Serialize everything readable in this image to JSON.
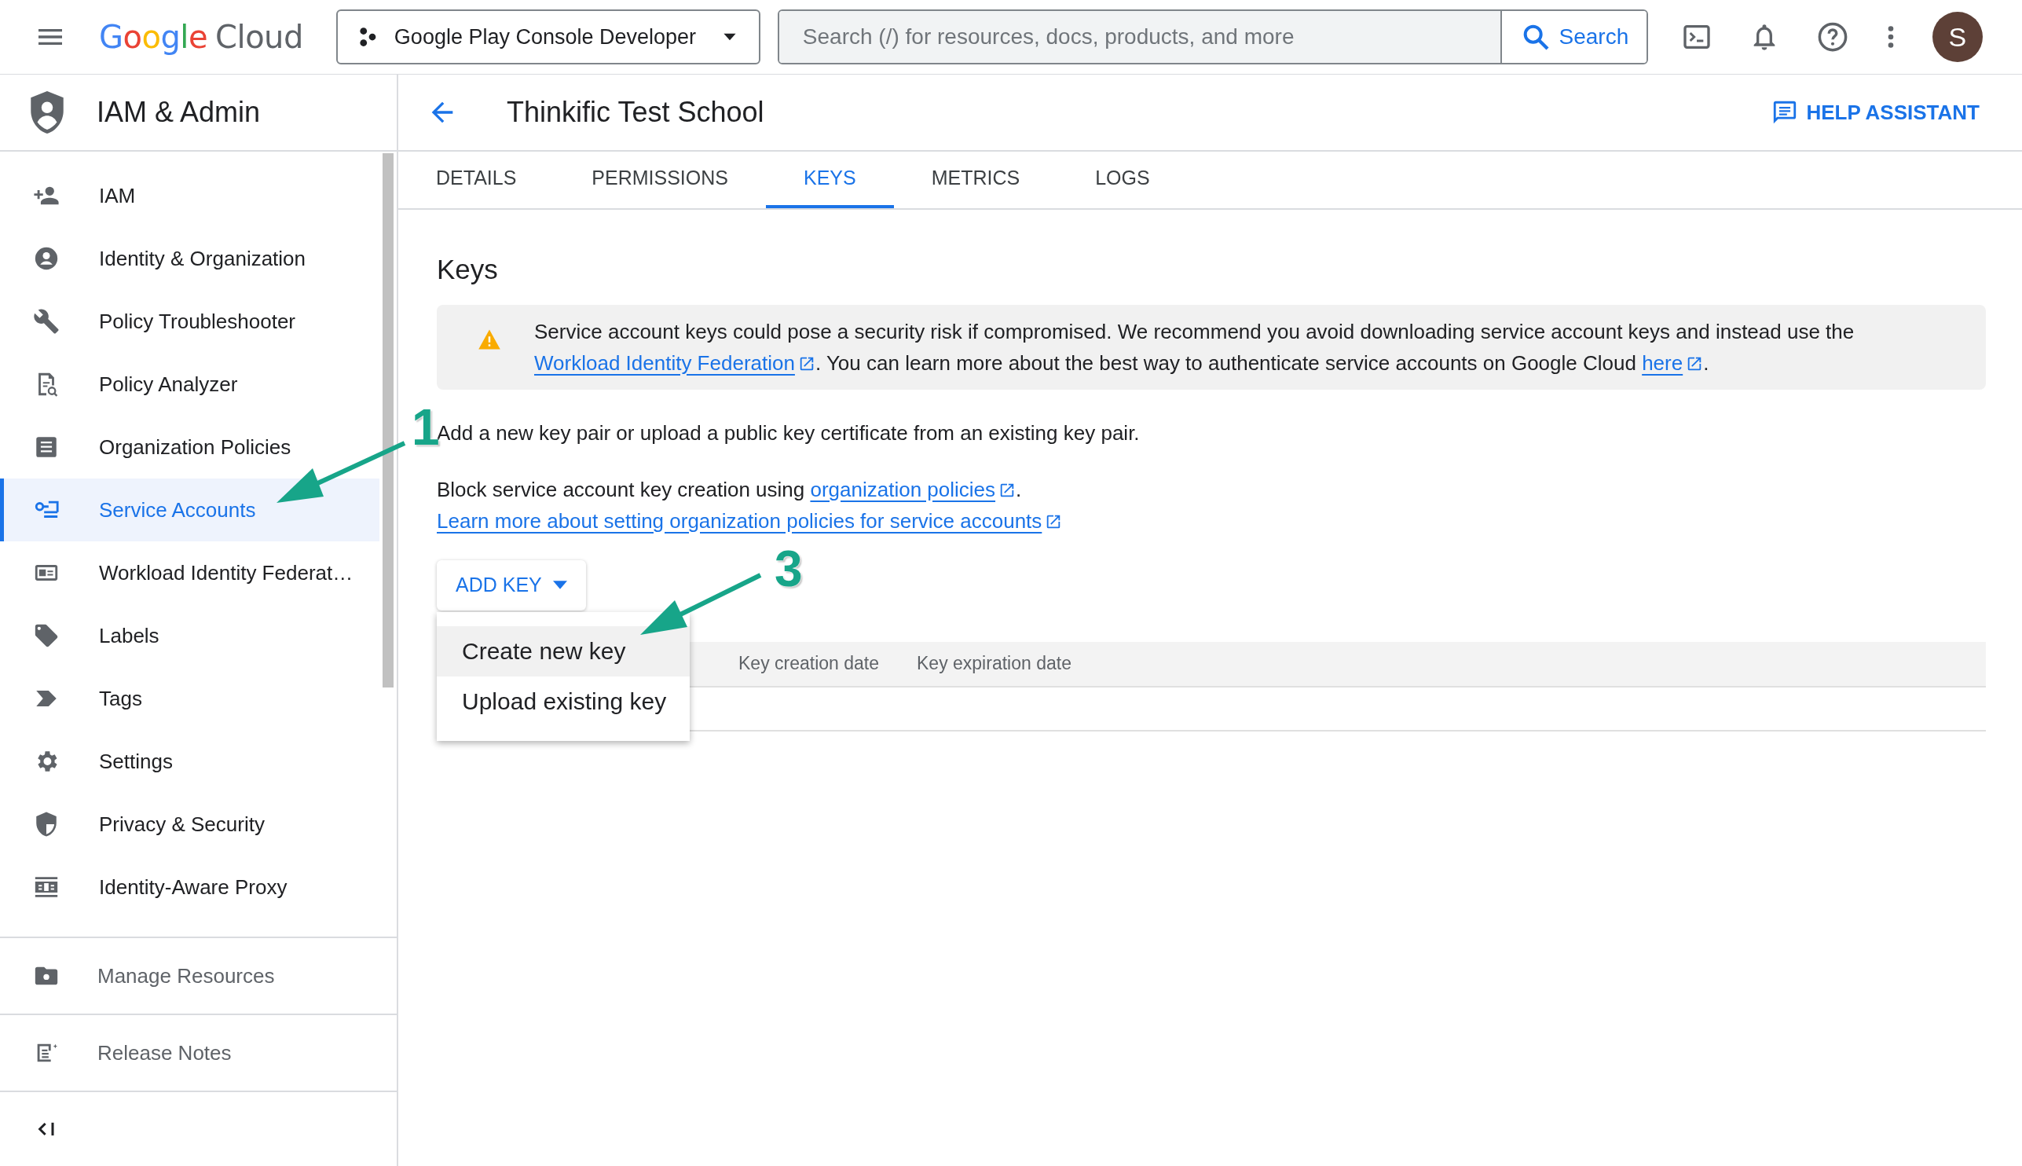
{
  "top_bar": {
    "logo": {
      "word": "Google",
      "suffix": "Cloud"
    },
    "project": "Google Play Console Developer",
    "search": {
      "placeholder": "Search (/) for resources, docs, products, and more",
      "button": "Search"
    },
    "avatar": "S"
  },
  "sidebar": {
    "title": "IAM & Admin",
    "items": [
      {
        "label": "IAM",
        "selected": false
      },
      {
        "label": "Identity & Organization",
        "selected": false
      },
      {
        "label": "Policy Troubleshooter",
        "selected": false
      },
      {
        "label": "Policy Analyzer",
        "selected": false
      },
      {
        "label": "Organization Policies",
        "selected": false
      },
      {
        "label": "Service Accounts",
        "selected": true
      },
      {
        "label": "Workload Identity Federat…",
        "selected": false
      },
      {
        "label": "Labels",
        "selected": false
      },
      {
        "label": "Tags",
        "selected": false
      },
      {
        "label": "Settings",
        "selected": false
      },
      {
        "label": "Privacy & Security",
        "selected": false
      },
      {
        "label": "Identity-Aware Proxy",
        "selected": false
      }
    ],
    "footer_items": [
      {
        "label": "Manage Resources"
      },
      {
        "label": "Release Notes"
      }
    ]
  },
  "page": {
    "title": "Thinkific Test School",
    "help": "HELP ASSISTANT",
    "tabs": [
      {
        "label": "DETAILS",
        "selected": false
      },
      {
        "label": "PERMISSIONS",
        "selected": false
      },
      {
        "label": "KEYS",
        "selected": true
      },
      {
        "label": "METRICS",
        "selected": false
      },
      {
        "label": "LOGS",
        "selected": false
      }
    ],
    "heading": "Keys",
    "warning": [
      {
        "kind": "text",
        "text": "Service account keys could pose a security risk if compromised. We recommend you avoid downloading service account keys and instead use the "
      },
      {
        "kind": "link",
        "text": "Workload Identity Federation"
      },
      {
        "kind": "text",
        "text": ". You can learn more about the best way to authenticate service accounts on Google Cloud "
      },
      {
        "kind": "link",
        "text": "here"
      },
      {
        "kind": "text",
        "text": "."
      }
    ],
    "intro": "Add a new key pair or upload a public key certificate from an existing key pair.",
    "policy_line": [
      {
        "kind": "text",
        "text": "Block service account key creation using "
      },
      {
        "kind": "link",
        "text": "organization policies"
      },
      {
        "kind": "text",
        "text": "."
      }
    ],
    "learn_more": "Learn more about setting organization policies for service accounts",
    "add_key": {
      "label": "ADD KEY",
      "menu": [
        {
          "label": "Create new key",
          "selected": true
        },
        {
          "label": "Upload existing key",
          "selected": false
        }
      ]
    },
    "table": {
      "columns": [
        "Key creation date",
        "Key expiration date"
      ]
    }
  },
  "annotations": [
    {
      "label": "1"
    },
    {
      "label": "3"
    }
  ]
}
